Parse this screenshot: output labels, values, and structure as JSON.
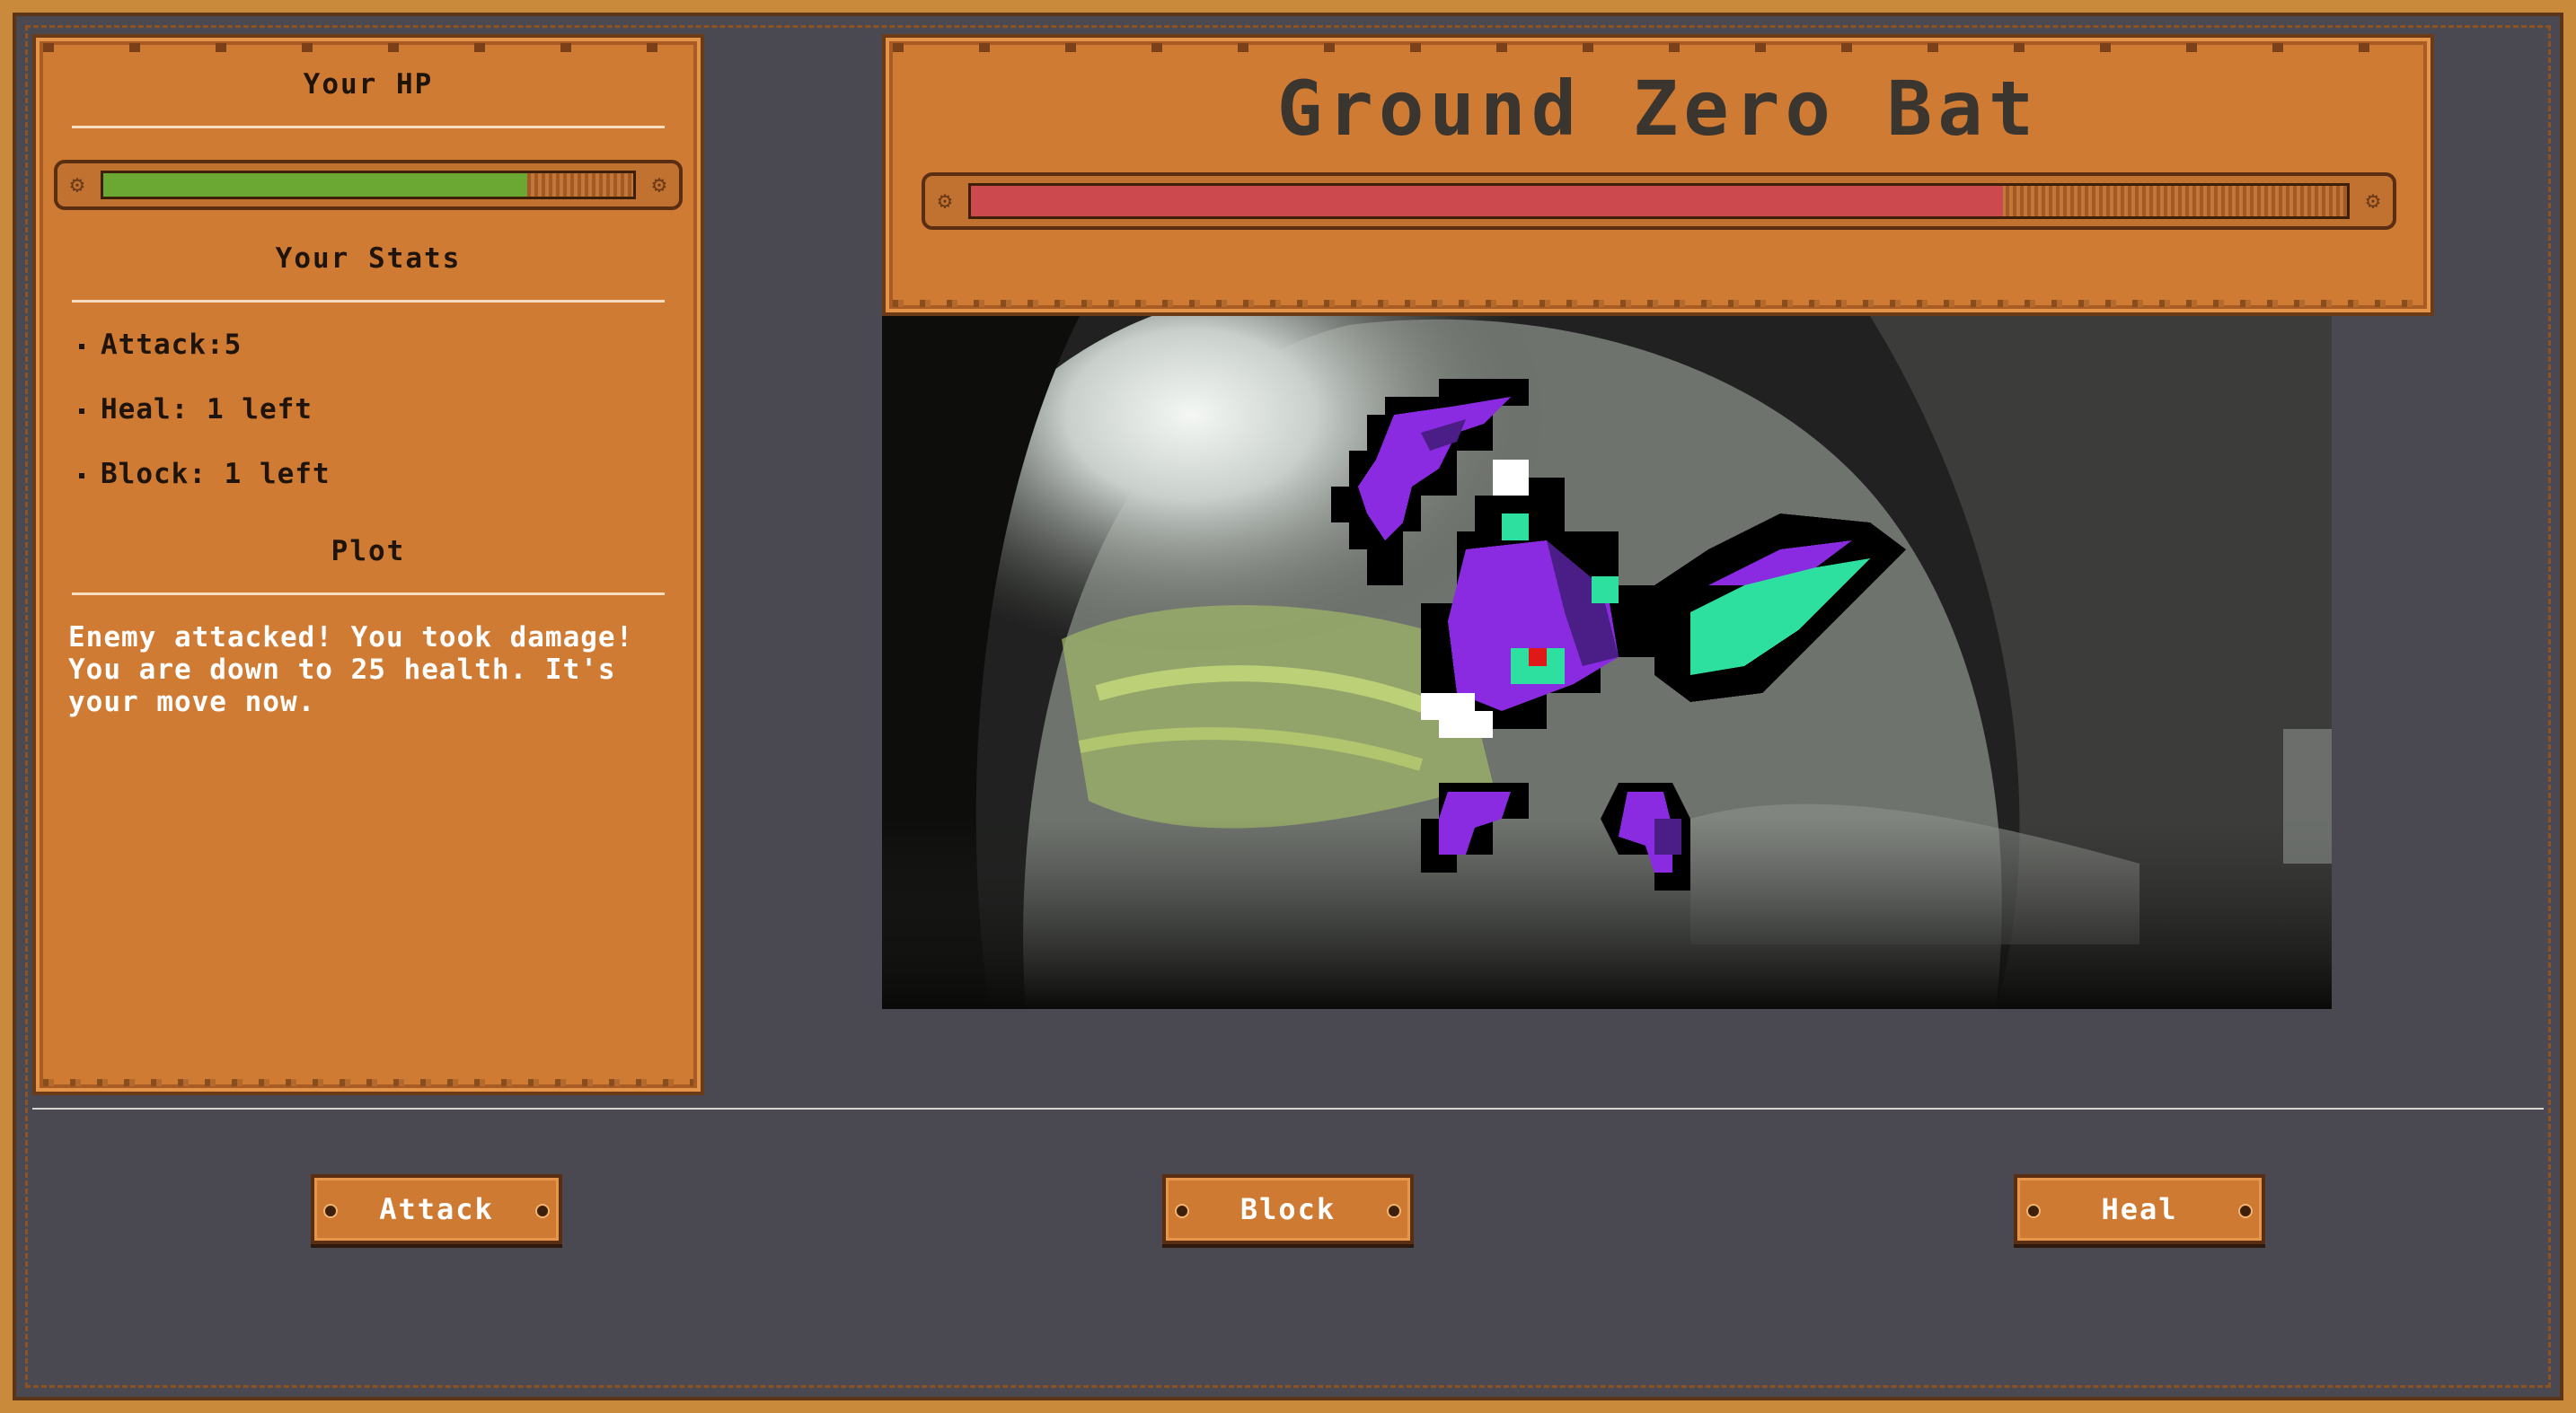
{
  "player": {
    "hp_title": "Your HP",
    "hp_fraction": 0.8,
    "hp_color": "#6aa833",
    "stats_title": "Your Stats",
    "stats": [
      "Attack:5",
      "Heal: 1 left",
      "Block: 1 left"
    ],
    "plot_title": "Plot",
    "plot_text": "Enemy attacked! You took damage! You are down to 25 health. It's your move now."
  },
  "enemy": {
    "name": "Ground Zero Bat",
    "hp_fraction": 0.75,
    "hp_color": "#cc4a4e"
  },
  "actions": [
    {
      "label": "Attack"
    },
    {
      "label": "Block"
    },
    {
      "label": "Heal"
    }
  ],
  "colors": {
    "wood": "#d07b34",
    "background": "#4a4850",
    "bat_purple": "#8a2be2",
    "bat_teal": "#2ee0a0"
  }
}
